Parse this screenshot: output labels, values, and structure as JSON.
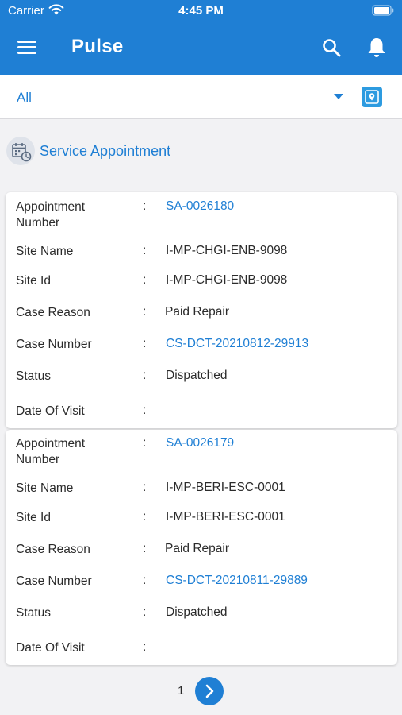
{
  "status_bar": {
    "carrier": "Carrier",
    "time": "4:45 PM"
  },
  "header": {
    "title": "Pulse",
    "icons": [
      "menu-icon",
      "search-icon",
      "bell-icon"
    ]
  },
  "filter": {
    "selected": "All",
    "icons": [
      "chevron-down-icon",
      "map-pin-icon"
    ]
  },
  "section": {
    "title": "Service Appointment",
    "icon": "calendar-clock-icon"
  },
  "colors": {
    "primary": "#1f7fd4",
    "link": "#1f7fd4",
    "background": "#f2f2f4"
  },
  "appointments": [
    {
      "labels": {
        "appointment_number": "Appointment Number",
        "site_name": "Site Name",
        "site_id": "Site Id",
        "case_reason": "Case Reason",
        "case_number": "Case Number",
        "status": "Status",
        "date_of_visit": "Date Of Visit"
      },
      "appointment_number": "SA-0026180",
      "site_name": "I-MP-CHGI-ENB-9098",
      "site_id": "I-MP-CHGI-ENB-9098",
      "case_reason": "Paid Repair",
      "case_number": "CS-DCT-20210812-29913",
      "status": "Dispatched",
      "date_of_visit": ""
    },
    {
      "labels": {
        "appointment_number": "Appointment Number",
        "site_name": "Site Name",
        "site_id": "Site Id",
        "case_reason": "Case Reason",
        "case_number": "Case Number",
        "status": "Status",
        "date_of_visit": "Date Of Visit"
      },
      "appointment_number": "SA-0026179",
      "site_name": "I-MP-BERI-ESC-0001",
      "site_id": "I-MP-BERI-ESC-0001",
      "case_reason": "Paid Repair",
      "case_number": "CS-DCT-20210811-29889",
      "status": "Dispatched",
      "date_of_visit": ""
    }
  ],
  "pagination": {
    "current_page": "1",
    "next_icon": "chevron-right-icon"
  }
}
